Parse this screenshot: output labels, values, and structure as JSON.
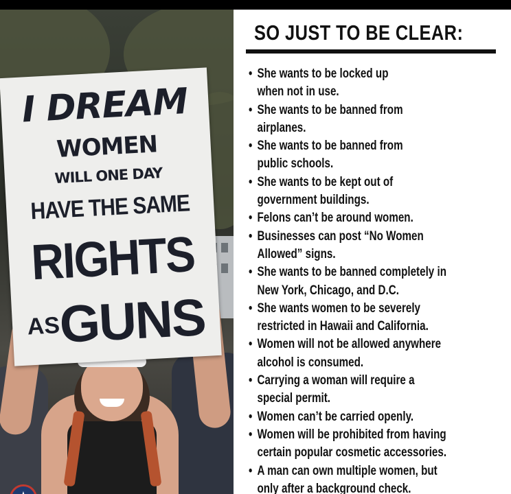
{
  "sign": {
    "line1": "I DREAM",
    "line2": "WOMEN",
    "line3": "WILL ONE DAY",
    "line4": "HAVE THE SAME",
    "line5": "RIGHTS",
    "line6_small": "AS",
    "line6_big": "GUNS"
  },
  "panel": {
    "heading": "SO JUST TO BE CLEAR:",
    "bullets": [
      [
        "She wants to be locked up",
        "when not in use."
      ],
      [
        "She wants to be banned from",
        "airplanes."
      ],
      [
        "She wants to be banned from",
        "public schools."
      ],
      [
        "She wants to be kept out of",
        "government buildings."
      ],
      [
        "Felons can’t be around women."
      ],
      [
        "Businesses can post “No Women",
        "Allowed” signs."
      ],
      [
        "She wants to be banned completely in",
        "New York, Chicago, and D.C."
      ],
      [
        "She wants women to be severely",
        "restricted in Hawaii and California."
      ],
      [
        "Women will not be allowed anywhere",
        "alcohol is consumed."
      ],
      [
        "Carrying a woman will require a",
        "special permit."
      ],
      [
        "Women can’t be carried openly."
      ],
      [
        "Women will be prohibited from having",
        "certain popular cosmetic accessories."
      ],
      [
        "A man can own multiple women, but",
        "only after a background check."
      ]
    ]
  },
  "badge": {
    "icon": "star-icon",
    "glyph": "★"
  },
  "colors": {
    "sign_ink": "#1c1f2a",
    "sign_paper": "#eeeeec",
    "text": "#111111"
  }
}
